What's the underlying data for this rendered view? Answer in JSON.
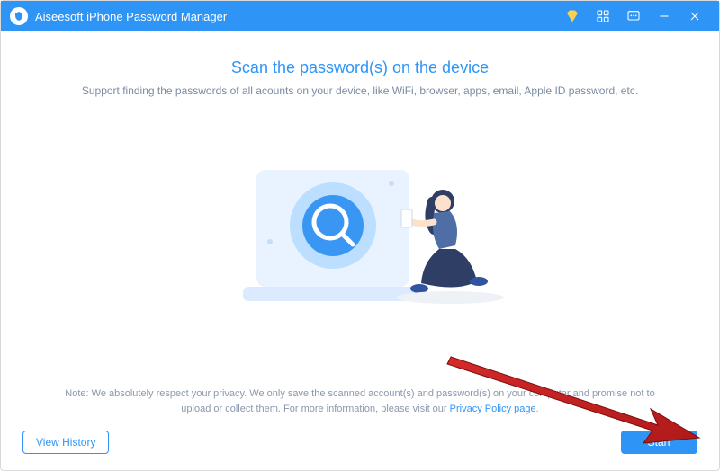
{
  "titlebar": {
    "title": "Aiseesoft iPhone Password Manager"
  },
  "main": {
    "heading": "Scan the password(s) on the device",
    "subheading": "Support finding the passwords of all acounts on your device, like  WiFi, browser, apps, email, Apple ID password, etc.",
    "note_prefix": "Note: We absolutely respect your privacy. We only save the scanned account(s) and password(s) on your computer and promise not to upload or collect them. For more information, please visit our ",
    "privacy_link": "Privacy Policy page",
    "note_suffix": "."
  },
  "footer": {
    "view_history": "View History",
    "start": "Start"
  }
}
